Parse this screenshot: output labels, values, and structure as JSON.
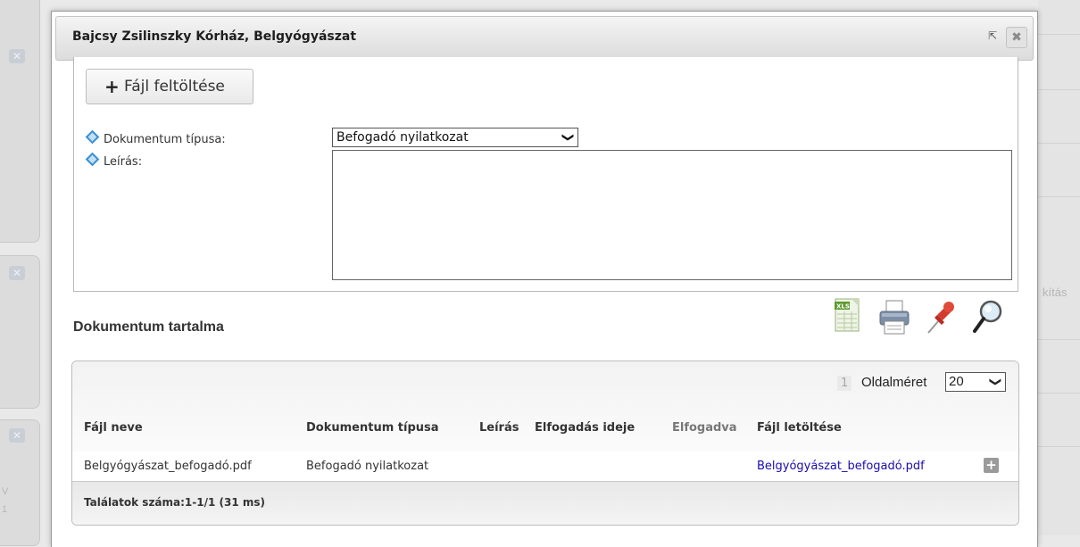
{
  "background": {
    "side_text": "kítás",
    "left_letters": [
      "V",
      "1"
    ]
  },
  "dialog": {
    "title": "Bajcsy Zsilinszky Kórház, Belgyógyászat",
    "popout_symbol": "⇱",
    "close_symbol": "✖"
  },
  "form": {
    "upload_label": "Fájl feltöltése",
    "doc_type_label": "Dokumentum típusa:",
    "doc_type_value": "Befogadó nyilatkozat",
    "description_label": "Leírás:",
    "description_value": ""
  },
  "content": {
    "section_title": "Dokumentum tartalma",
    "toolbar": [
      "excel-export-icon",
      "print-icon",
      "pin-icon",
      "search-icon"
    ],
    "xls_text": "XLS"
  },
  "grid": {
    "page_number": "1",
    "page_size_label": "Oldalméret",
    "page_size": "20",
    "columns": [
      "Fájl neve",
      "Dokumentum típusa",
      "Leírás",
      "Elfogadás ideje",
      "Elfogadva",
      "Fájl letöltése"
    ],
    "rows": [
      {
        "file_name": "Belgyógyászat_befogadó.pdf",
        "doc_type": "Befogadó nyilatkozat",
        "description": "",
        "accepted_time": "",
        "accepted": "",
        "download": "Belgyógyászat_befogadó.pdf"
      }
    ],
    "footer": "Találatok száma:1-1/1 (31 ms)"
  },
  "colors": {
    "link": "#1a0dab",
    "accent_diamond": "#3a8fd0",
    "pin_red": "#d23b2e"
  }
}
